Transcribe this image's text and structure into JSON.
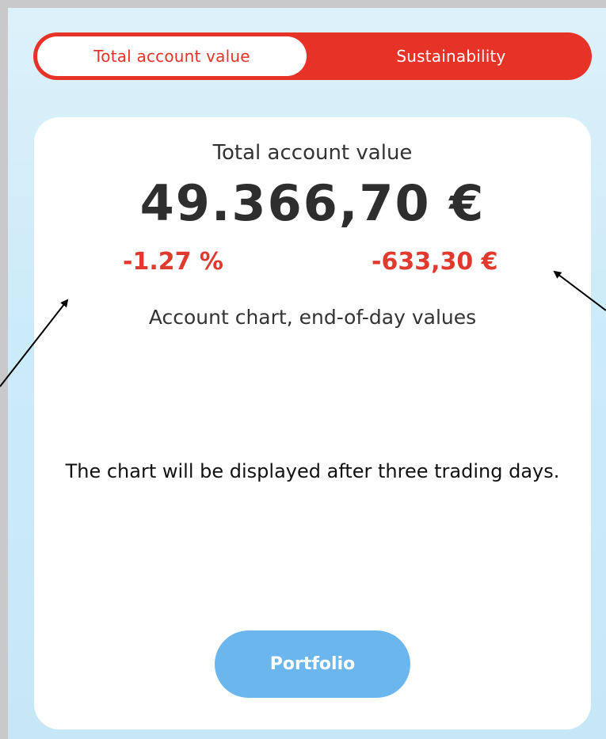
{
  "tabs": {
    "active_label": "Total account value",
    "inactive_label": "Sustainability"
  },
  "account": {
    "title": "Total account value",
    "value": "49.366,70 €",
    "change_percent": "-1.27 %",
    "change_amount": "-633,30 €"
  },
  "chart": {
    "title": "Account chart, end-of-day values",
    "message": "The chart will be displayed after three trading days."
  },
  "actions": {
    "portfolio_label": "Portfolio"
  },
  "colors": {
    "brand_red": "#e73327",
    "negative_red": "#e03a2f",
    "button_blue": "#6cb6ee",
    "background_blue": "#cdebf8"
  }
}
